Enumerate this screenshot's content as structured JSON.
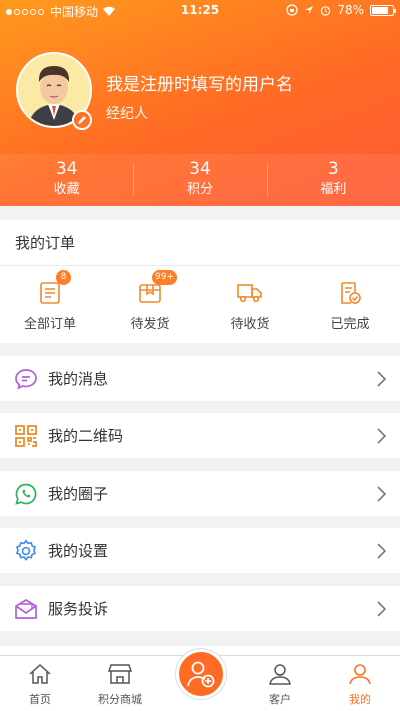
{
  "status_bar": {
    "carrier": "中国移动",
    "time": "11:25",
    "battery": "78%"
  },
  "profile": {
    "username": "我是注册时填写的用户名",
    "role": "经纪人"
  },
  "stats": [
    {
      "value": "34",
      "label": "收藏"
    },
    {
      "value": "34",
      "label": "积分"
    },
    {
      "value": "3",
      "label": "福利"
    }
  ],
  "orders": {
    "title": "我的订单",
    "items": [
      {
        "label": "全部订单",
        "badge": "8",
        "icon": "order-list-icon"
      },
      {
        "label": "待发货",
        "badge": "99+",
        "icon": "package-icon"
      },
      {
        "label": "待收货",
        "badge": "",
        "icon": "truck-icon"
      },
      {
        "label": "已完成",
        "badge": "",
        "icon": "completed-icon"
      }
    ]
  },
  "menu": [
    {
      "label": "我的消息",
      "icon": "message-icon",
      "color": "#b25fd8"
    },
    {
      "label": "我的二维码",
      "icon": "qrcode-icon",
      "color": "#f08a2a"
    },
    {
      "label": "我的圈子",
      "icon": "circle-chat-icon",
      "color": "#2ab45a"
    },
    {
      "label": "我的设置",
      "icon": "gear-icon",
      "color": "#3d8ee8"
    },
    {
      "label": "服务投诉",
      "icon": "complaint-mail-icon",
      "color": "#b25fd8"
    }
  ],
  "tabbar": [
    {
      "label": "首页",
      "icon": "home-icon"
    },
    {
      "label": "积分商城",
      "icon": "shop-icon"
    },
    {
      "label": "",
      "icon": "add-user-icon"
    },
    {
      "label": "客户",
      "icon": "client-icon"
    },
    {
      "label": "我的",
      "icon": "profile-icon",
      "active": true
    }
  ],
  "colors": {
    "accent": "#ff6f24",
    "header_start": "#ff9a1e",
    "header_end": "#ff5a38"
  }
}
